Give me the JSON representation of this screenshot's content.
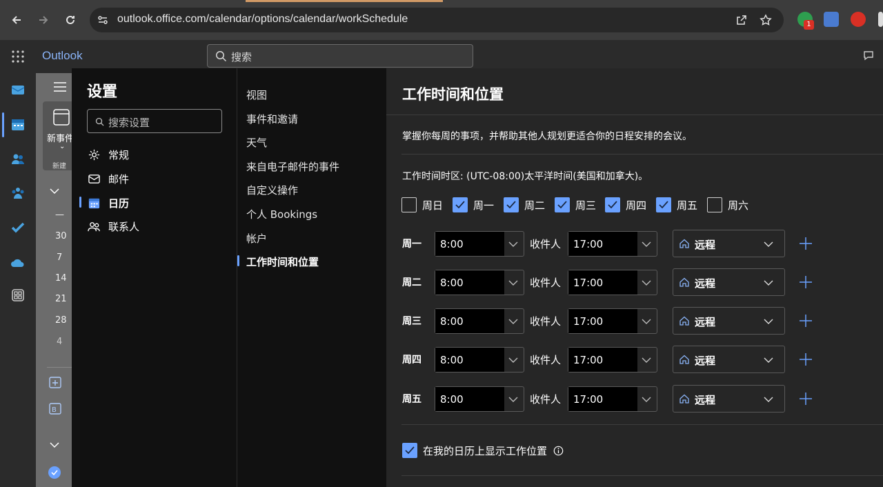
{
  "browser": {
    "url": "outlook.office.com/calendar/options/calendar/workSchedule",
    "extension_badge": "1"
  },
  "header": {
    "app_title": "Outlook",
    "search_placeholder": "搜索"
  },
  "calendar_strip": {
    "new_event": "新事件",
    "new_label": "新建",
    "dates": [
      "—",
      "30",
      "7",
      "14",
      "21",
      "28",
      "4"
    ]
  },
  "settings": {
    "title": "设置",
    "search_placeholder": "搜索设置",
    "categories": [
      {
        "label": "常规",
        "icon": "gear-icon"
      },
      {
        "label": "邮件",
        "icon": "mail-icon"
      },
      {
        "label": "日历",
        "icon": "calendar-icon",
        "active": true
      },
      {
        "label": "联系人",
        "icon": "people-icon"
      }
    ],
    "subsections": [
      "视图",
      "事件和邀请",
      "天气",
      "来自电子邮件的事件",
      "自定义操作",
      "个人 Bookings",
      "帐户",
      "工作时间和位置"
    ],
    "active_subsection": "工作时间和位置"
  },
  "pane": {
    "title": "工作时间和位置",
    "description": "掌握你每周的事项，并帮助其他人规划更适合你的日程安排的会议。",
    "timezone": "工作时间时区: (UTC-08:00)太平洋时间(美国和加拿大)。",
    "days": [
      {
        "label": "周日",
        "checked": false
      },
      {
        "label": "周一",
        "checked": true
      },
      {
        "label": "周二",
        "checked": true
      },
      {
        "label": "周三",
        "checked": true
      },
      {
        "label": "周四",
        "checked": true
      },
      {
        "label": "周五",
        "checked": true
      },
      {
        "label": "周六",
        "checked": false
      }
    ],
    "to_label": "收件人",
    "schedule": [
      {
        "day": "周一",
        "start": "8:00",
        "end": "17:00",
        "location": "远程"
      },
      {
        "day": "周二",
        "start": "8:00",
        "end": "17:00",
        "location": "远程"
      },
      {
        "day": "周三",
        "start": "8:00",
        "end": "17:00",
        "location": "远程"
      },
      {
        "day": "周四",
        "start": "8:00",
        "end": "17:00",
        "location": "远程"
      },
      {
        "day": "周五",
        "start": "8:00",
        "end": "17:00",
        "location": "远程"
      }
    ],
    "show_location": {
      "label": "在我的日历上显示工作位置",
      "checked": true
    }
  },
  "colors": {
    "accent": "#6aa1ff",
    "panel_dark": "#111111",
    "pane_bg": "#262626"
  }
}
